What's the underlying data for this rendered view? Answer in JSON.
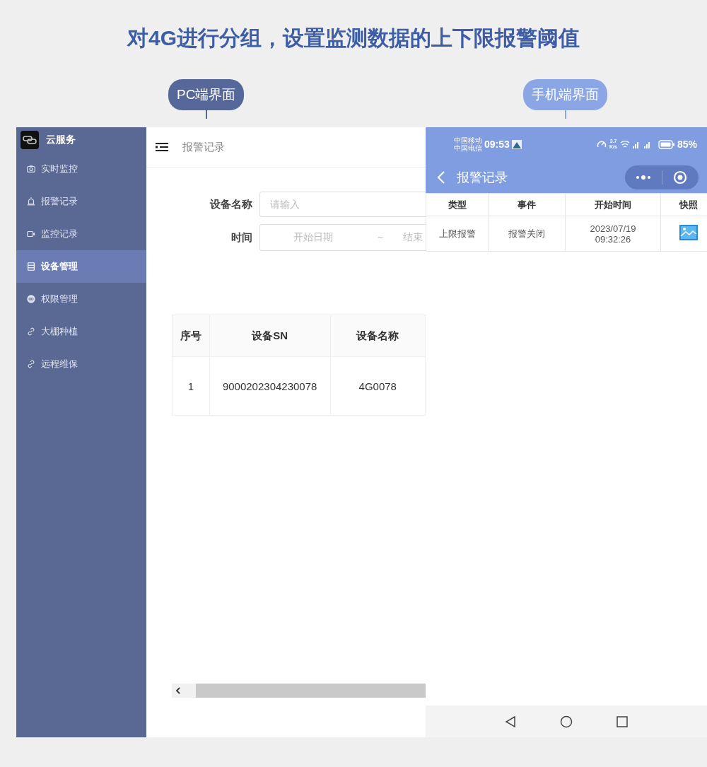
{
  "headline": "对4G进行分组，设置监测数据的上下限报警阈值",
  "pc_label": "PC端界面",
  "mobile_label": "手机端界面",
  "pc": {
    "brand": "云服务",
    "sidebar": [
      {
        "label": "实时监控",
        "selected": false
      },
      {
        "label": "报警记录",
        "selected": false
      },
      {
        "label": "监控记录",
        "selected": false
      },
      {
        "label": "设备管理",
        "selected": true
      },
      {
        "label": "权限管理",
        "selected": false
      },
      {
        "label": "大棚种植",
        "selected": false
      },
      {
        "label": "远程维保",
        "selected": false
      }
    ],
    "page_title": "报警记录",
    "name_filter": {
      "label": "设备名称",
      "placeholder": "请输入"
    },
    "time_filter": {
      "label": "时间",
      "start_placeholder": "开始日期",
      "separator": "~",
      "end_placeholder": "结束"
    },
    "table": {
      "columns": [
        "序号",
        "设备SN",
        "设备名称"
      ],
      "rows": [
        [
          "1",
          "9000202304230078",
          "4G0078"
        ]
      ]
    }
  },
  "mobile": {
    "status_bar": {
      "carrier_1": "中国移动",
      "carrier_2": "中国电信",
      "time": "09:53",
      "speed": "3.7",
      "speed_unit": "K/s",
      "battery": "85%"
    },
    "title": "报警记录",
    "table": {
      "columns": [
        "类型",
        "事件",
        "开始时间",
        "快照"
      ],
      "rows": [
        {
          "type": "上限报警",
          "event": "报警关闭",
          "start_time": "2023/07/19 09:32:26"
        }
      ]
    }
  }
}
